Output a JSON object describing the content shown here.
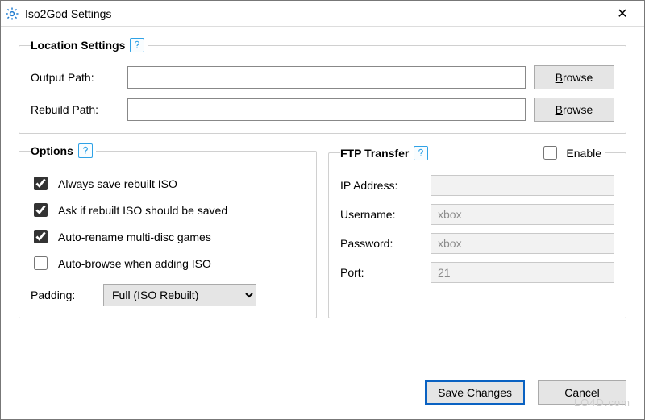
{
  "window": {
    "title": "Iso2God Settings"
  },
  "location": {
    "legend": "Location Settings",
    "output_label": "Output Path:",
    "output_value": "",
    "rebuild_label": "Rebuild Path:",
    "rebuild_value": "",
    "browse_label": "Browse",
    "browse_mnemonic": "B"
  },
  "options": {
    "legend": "Options",
    "always_save": {
      "label": "Always save rebuilt ISO",
      "checked": true
    },
    "ask_save": {
      "label": "Ask if rebuilt ISO should be saved",
      "checked": true
    },
    "auto_rename": {
      "label": "Auto-rename multi-disc games",
      "checked": true
    },
    "auto_browse": {
      "label": "Auto-browse when adding ISO",
      "checked": false
    },
    "padding_label": "Padding:",
    "padding_value": "Full (ISO Rebuilt)"
  },
  "ftp": {
    "legend": "FTP Transfer",
    "enable_label": "Enable",
    "enable_checked": false,
    "ip_label": "IP Address:",
    "ip_value": "",
    "user_label": "Username:",
    "user_value": "xbox",
    "pass_label": "Password:",
    "pass_value": "xbox",
    "port_label": "Port:",
    "port_value": "21"
  },
  "footer": {
    "save": "Save Changes",
    "cancel": "Cancel"
  },
  "watermark": "LO4D.com"
}
